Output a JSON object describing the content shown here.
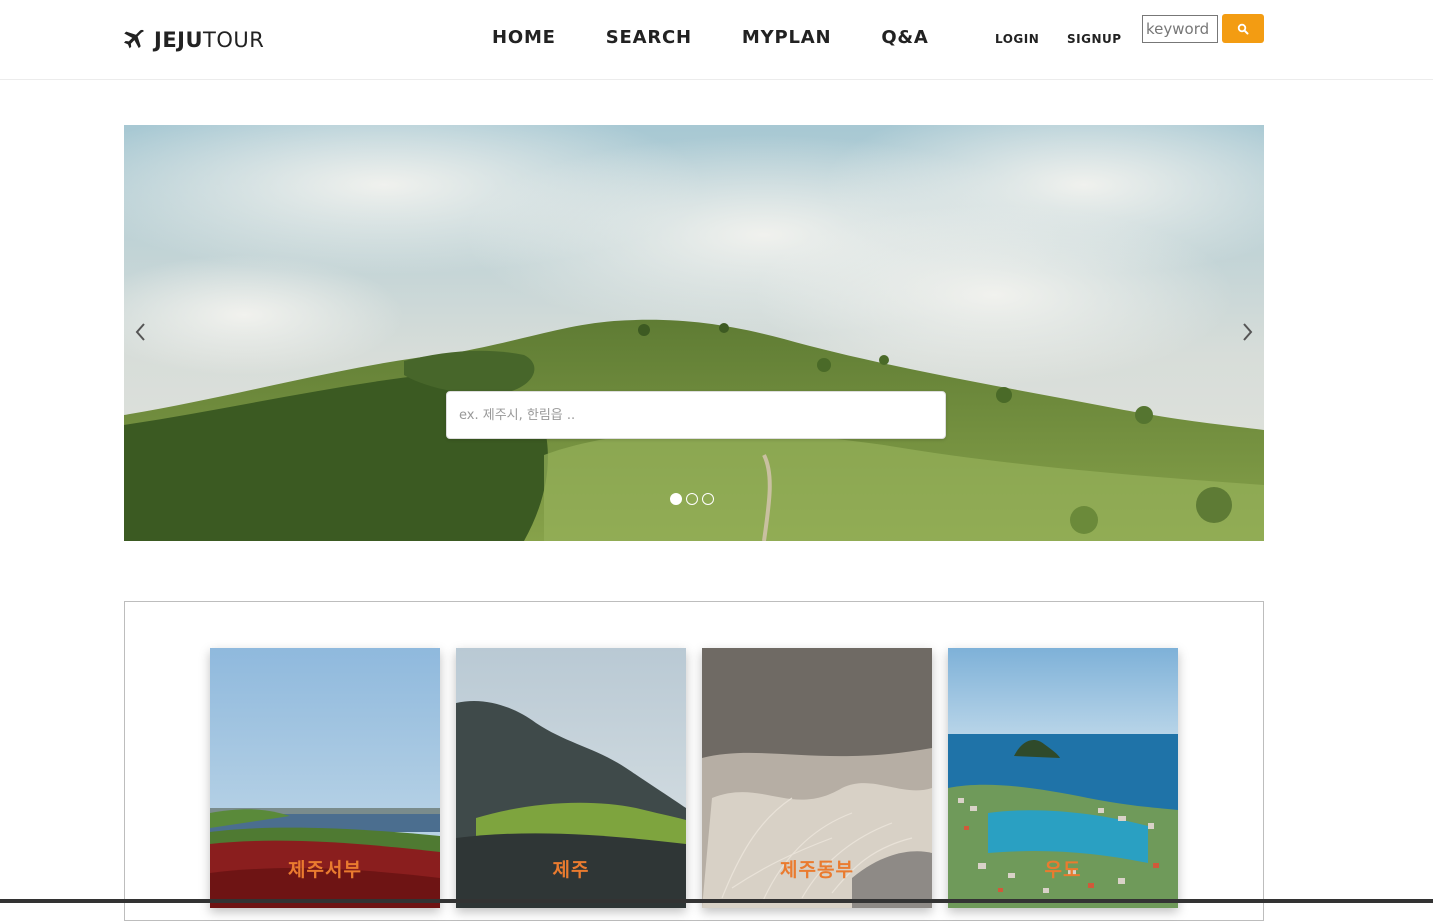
{
  "header": {
    "logo_bold": "JEJU",
    "logo_light": "TOUR",
    "nav": [
      "HOME",
      "SEARCH",
      "MYPLAN",
      "Q&A"
    ],
    "login_label": "LOGIN",
    "signup_label": "SIGNUP",
    "search_placeholder": "keyword"
  },
  "hero": {
    "search_placeholder": "ex. 제주시, 한림읍 ..",
    "slide_count": 3,
    "active_slide": 1
  },
  "regions": [
    {
      "label": "제주서부"
    },
    {
      "label": "제주"
    },
    {
      "label": "제주동부"
    },
    {
      "label": "우도"
    }
  ],
  "colors": {
    "accent": "#f39c12",
    "card_label": "#ea7b2f"
  },
  "icons": {
    "logo": "plane-icon",
    "search_button": "search-icon",
    "prev": "chevron-left-icon",
    "next": "chevron-right-icon"
  }
}
